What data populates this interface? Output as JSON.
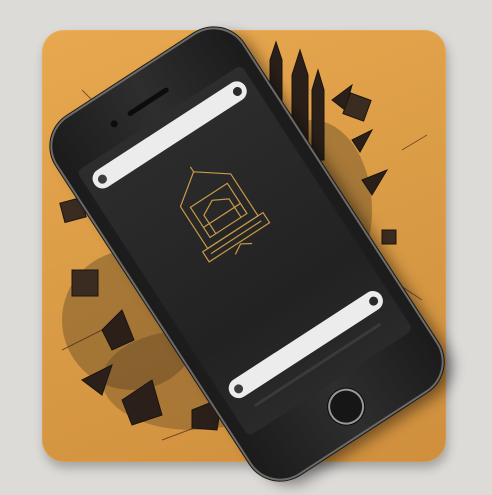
{
  "scene": {
    "background_color": "#dddbd8",
    "coaster_color": "#d99a45",
    "art_color": "#2b2118"
  },
  "phone": {
    "search_bar": {
      "text": "",
      "left_icon": "profile-dot-icon",
      "right_icon": "menu-dot-icon"
    },
    "illustration_icon": "ornate-building-icon",
    "body_text": "",
    "bottom_bar": {
      "text": "",
      "left_icon": "profile-dot-icon",
      "right_icon": "menu-dot-icon"
    },
    "home_button_icon": "home-button-icon"
  }
}
